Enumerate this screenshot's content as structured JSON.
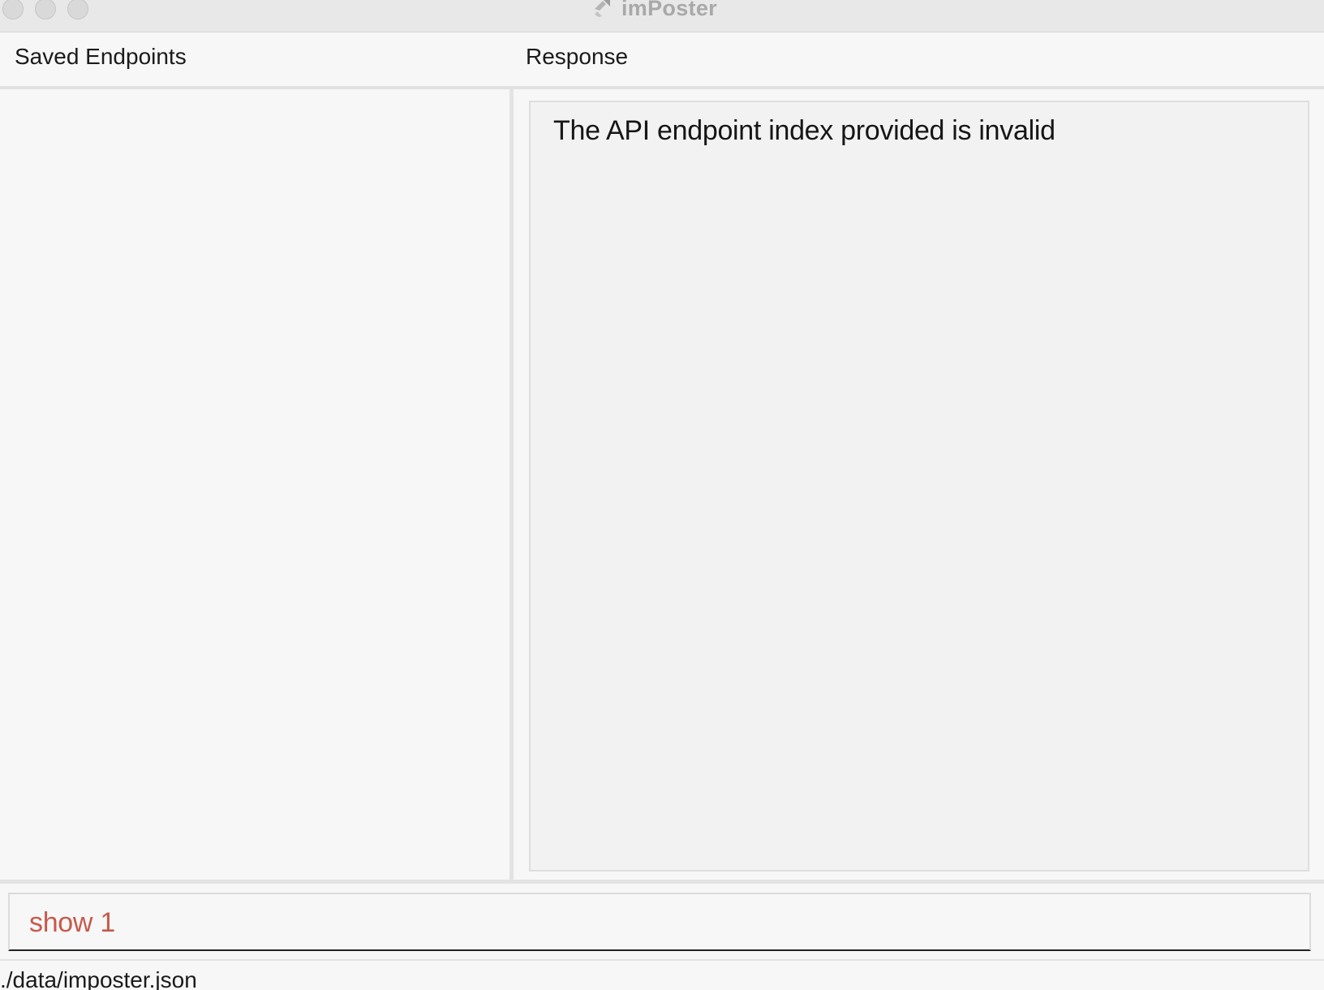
{
  "window": {
    "title": "imPoster",
    "app_icon": "imposter-logo-icon"
  },
  "panels": {
    "left_header": "Saved Endpoints",
    "right_header": "Response"
  },
  "saved_endpoints": [],
  "response": {
    "text": "The API endpoint index provided is invalid"
  },
  "command": {
    "value": "show 1",
    "color": "#c65a4c"
  },
  "status_bar": {
    "path": "./data/imposter.json"
  }
}
